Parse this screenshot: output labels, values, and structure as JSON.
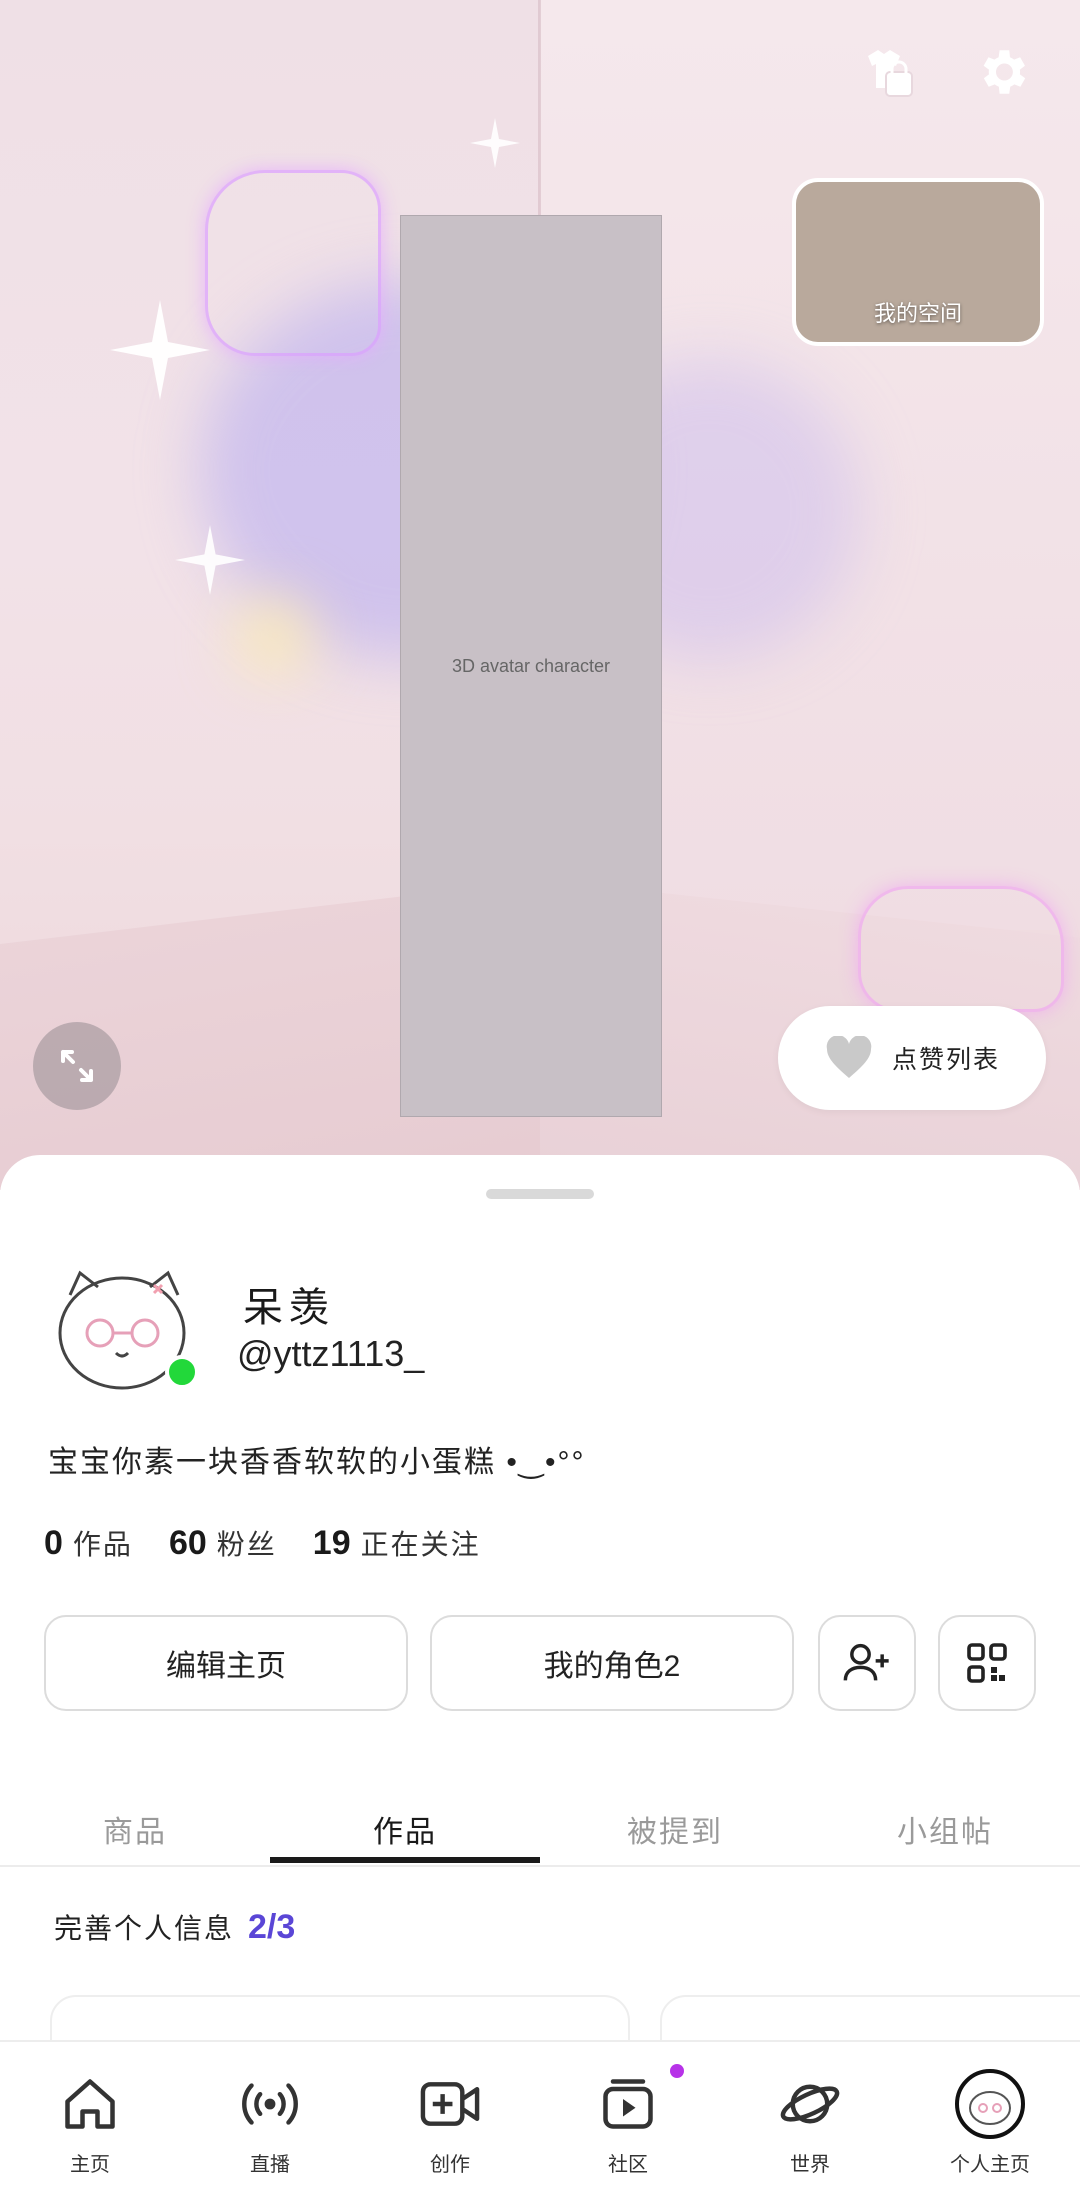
{
  "scene": {
    "space_label": "我的空间",
    "like_list_label": "点赞列表",
    "avatar_image_label": "3D avatar character"
  },
  "profile": {
    "nickname": "呆羡",
    "handle": "@yttz1113_",
    "bio": "宝宝你素一块香香软软的小蛋糕 •‿•°°",
    "stats": [
      {
        "value": "0",
        "label": "作品"
      },
      {
        "value": "60",
        "label": "粉丝"
      },
      {
        "value": "19",
        "label": "正在关注"
      }
    ],
    "actions": {
      "edit": "编辑主页",
      "roles": "我的角色2"
    },
    "tabs": [
      "商品",
      "作品",
      "被提到",
      "小组帖"
    ],
    "active_tab": "作品",
    "complete_label": "完善个人信息",
    "complete_progress": "2/3"
  },
  "nav": [
    {
      "label": "主页",
      "icon": "home-icon"
    },
    {
      "label": "直播",
      "icon": "live-icon"
    },
    {
      "label": "创作",
      "icon": "create-video-icon"
    },
    {
      "label": "社区",
      "icon": "community-icon"
    },
    {
      "label": "世界",
      "icon": "planet-icon"
    },
    {
      "label": "个人主页",
      "icon": "profile-avatar-icon"
    }
  ],
  "colors": {
    "accent": "#5a46d6",
    "online": "#22d83a",
    "badge": "#b733e8"
  }
}
